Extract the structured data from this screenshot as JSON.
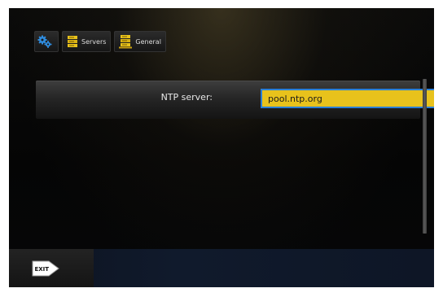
{
  "breadcrumb": {
    "items": [
      {
        "label": "",
        "icon": "settings-gears-icon"
      },
      {
        "label": "Servers",
        "icon": "server-icon"
      },
      {
        "label": "General",
        "icon": "server-icon"
      }
    ]
  },
  "settings": {
    "ntp_label": "NTP server:",
    "ntp_value": "pool.ntp.org"
  },
  "footer": {
    "exit_label": "EXIT"
  },
  "colors": {
    "input_bg": "#e8c21c",
    "focus_border": "#2b7fd6",
    "gear_blue": "#2f8de0",
    "server_yellow": "#e8c21c"
  }
}
